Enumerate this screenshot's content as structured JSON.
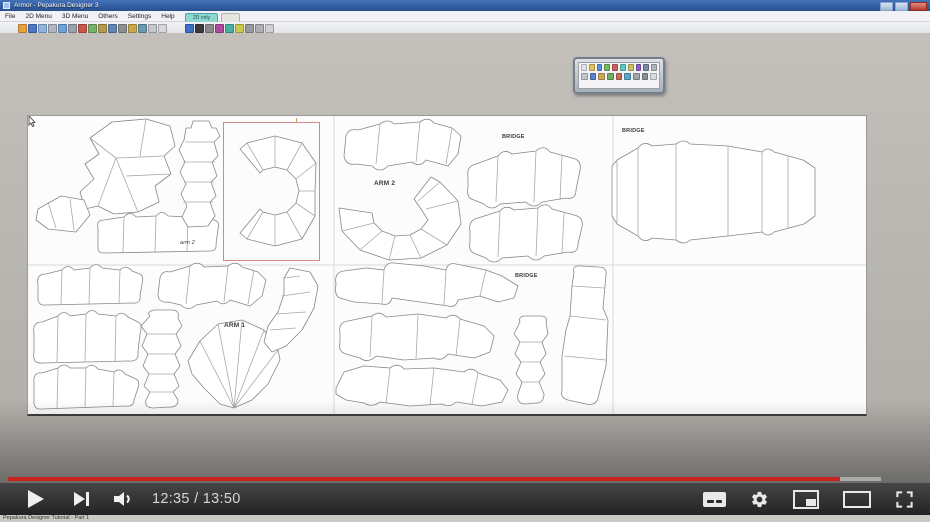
{
  "window": {
    "title": "Armor - Pepakura Designer 3",
    "mode_badge": "2D only"
  },
  "menu_items": [
    "File",
    "2D Menu",
    "3D Menu",
    "Others",
    "Settings",
    "Help"
  ],
  "toolbar_colors_a": [
    "#e8a33d",
    "#4a76c9",
    "#8fb6e0",
    "#b0b6bf",
    "#6fa1d9",
    "#9aa3ad",
    "#c9574a",
    "#76b26a",
    "#b59a4e",
    "#5f87b5",
    "#8f8f8f",
    "#c9a94a",
    "#6a9ab2",
    "#c7c7cb",
    "#d8d8dc"
  ],
  "toolbar_colors_b": [
    "#3d6fc9",
    "#3a3a3a",
    "#8a8a8a",
    "#b04a9e",
    "#4ab0a0",
    "#c9c94a",
    "#9a9a9e",
    "#b0b0b4",
    "#d0d0d4"
  ],
  "minibar_row1": [
    "#dfe3ea",
    "#e8c05a",
    "#5a8fe8",
    "#7ab55f",
    "#c95f5f",
    "#5fc9c0",
    "#c9c05f",
    "#8f5fc9",
    "#7a8aa0",
    "#b0b4bc"
  ],
  "minibar_row2": [
    "#c2c6ce",
    "#5a7fd0",
    "#d0a65a",
    "#6fae62",
    "#c96a5a",
    "#5aa6c9",
    "#a0a4ac",
    "#8a8e96",
    "#d8dce2"
  ],
  "canvas_labels": [
    {
      "text": "arm 2",
      "style": "left:152px;top:124px;font-size:5.5px;font-style:italic"
    },
    {
      "text": "ARM 2",
      "style": "left:346px;top:64px;font-size:6.5px;font-weight:bold"
    },
    {
      "text": "BRIDGE",
      "style": "left:474px;top:18px;font-size:5.5px;font-weight:bold"
    },
    {
      "text": "BRIDGE",
      "style": "left:594px;top:12px;font-size:5.5px;font-weight:bold"
    },
    {
      "text": "ARM 1",
      "style": "left:196px;top:206px;font-size:6.5px;font-weight:bold"
    },
    {
      "text": "BRIDGE",
      "style": "left:487px;top:157px;font-size:5.5px;font-weight:bold"
    }
  ],
  "player": {
    "current_time": "12:35",
    "duration": "13:50",
    "time_display": "12:35 / 13:50",
    "progress_style": "width:91%;background:#c9231f",
    "buffer_style": "left:91%;width:4.5%;background:#a9a9a9"
  },
  "page_below": {
    "video_title": "Pepakura Designer Tutorial - Part 1"
  }
}
